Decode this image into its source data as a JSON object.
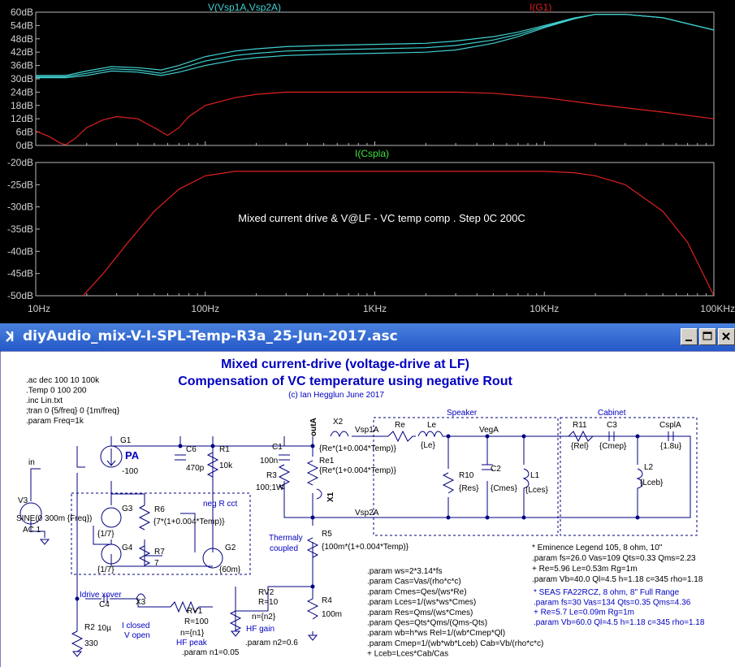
{
  "window": {
    "title": "diyAudio_mix-V-I-SPL-Temp-R3a_25-Jun-2017.asc"
  },
  "plot": {
    "annotation": "Mixed current drive & V@LF - VC temp comp . Step 0C 200C",
    "top_traces": [
      {
        "label": "V(Vsp1A,Vsp2A)",
        "color": "#40d0d0"
      },
      {
        "label": "I(G1)",
        "color": "#e02020"
      }
    ],
    "bottom_trace": {
      "label": "I(Cspla)",
      "color": "#40e040"
    },
    "top_y_ticks": [
      "60dB",
      "54dB",
      "48dB",
      "42dB",
      "36dB",
      "30dB",
      "24dB",
      "18dB",
      "12dB",
      "6dB",
      "0dB"
    ],
    "bottom_y_ticks": [
      "-20dB",
      "-25dB",
      "-30dB",
      "-35dB",
      "-40dB",
      "-45dB",
      "-50dB"
    ],
    "x_ticks": [
      "10Hz",
      "100Hz",
      "1KHz",
      "10KHz",
      "100KHz"
    ]
  },
  "chart_data": [
    {
      "type": "line",
      "x_scale": "log",
      "xlim": [
        10,
        100000
      ],
      "ylim": [
        0,
        60
      ],
      "y_unit": "dB",
      "grid": false,
      "series": [
        {
          "name": "V(Vsp1A,Vsp2A)",
          "variant": 1,
          "x": [
            10,
            15,
            20,
            28,
            40,
            55,
            70,
            100,
            150,
            200,
            300,
            500,
            1000,
            2000,
            3000,
            5000,
            7000,
            10000,
            15000,
            20000,
            30000,
            50000,
            100000
          ],
          "y": [
            30.5,
            30.5,
            31.5,
            33.5,
            33,
            31.5,
            33,
            36,
            38.5,
            39.5,
            40.5,
            41,
            41.5,
            42,
            43,
            46,
            49,
            53,
            57,
            59,
            59,
            57.5,
            52
          ]
        },
        {
          "name": "V(Vsp1A,Vsp2A)",
          "variant": 2,
          "x": [
            10,
            15,
            20,
            28,
            40,
            55,
            70,
            100,
            150,
            200,
            300,
            500,
            1000,
            2000,
            3000,
            5000,
            7000,
            10000,
            15000,
            20000,
            30000,
            50000,
            100000
          ],
          "y": [
            31,
            31,
            32.5,
            34.5,
            34,
            32.5,
            34.5,
            38,
            40.5,
            41.5,
            42.5,
            43,
            43.5,
            44,
            45,
            47.5,
            50,
            53.5,
            57.2,
            59,
            59,
            57.5,
            52
          ]
        },
        {
          "name": "V(Vsp1A,Vsp2A)",
          "variant": 3,
          "x": [
            10,
            15,
            20,
            28,
            40,
            55,
            70,
            100,
            150,
            200,
            300,
            500,
            1000,
            2000,
            3000,
            5000,
            7000,
            10000,
            15000,
            20000,
            30000,
            50000,
            100000
          ],
          "y": [
            31.5,
            31.5,
            33.5,
            35.5,
            35,
            34,
            36,
            40,
            42.5,
            43.5,
            44.5,
            45,
            45.5,
            46,
            47,
            49,
            51,
            54,
            57.4,
            59,
            59,
            57.5,
            52
          ]
        },
        {
          "name": "I(G1)",
          "x": [
            10,
            12,
            14,
            15,
            17,
            20,
            25,
            30,
            40,
            50,
            60,
            70,
            80,
            100,
            150,
            200,
            300,
            500,
            1000,
            2000,
            3000,
            5000,
            10000,
            20000,
            50000,
            100000
          ],
          "y": [
            6.5,
            4,
            1,
            0.3,
            3,
            8,
            11.5,
            13,
            12,
            8,
            4.5,
            8,
            13,
            18,
            21.5,
            23,
            24,
            24,
            24,
            24,
            24,
            23.5,
            21.5,
            18.5,
            15,
            12
          ]
        }
      ]
    },
    {
      "type": "line",
      "x_scale": "log",
      "xlim": [
        10,
        100000
      ],
      "ylim": [
        -50,
        -20
      ],
      "y_unit": "dB",
      "grid": false,
      "series": [
        {
          "name": "I(Cspla)",
          "x": [
            19,
            25,
            35,
            50,
            70,
            100,
            150,
            200,
            300,
            500,
            1000,
            2000,
            5000,
            10000,
            15000,
            20000,
            30000,
            50000,
            70000,
            100000
          ],
          "y": [
            -50,
            -45,
            -38,
            -31,
            -26,
            -23,
            -22,
            -22,
            -22,
            -22,
            -22,
            -22,
            -22,
            -22,
            -22.3,
            -23,
            -25,
            -31,
            -38,
            -50
          ]
        }
      ]
    }
  ],
  "schematic": {
    "title_line1": "Mixed current-drive (voltage-drive at LF)",
    "title_line2": "Compensation of VC temperature using negative Rout",
    "credit": "(c) Ian Hegglun June 2017",
    "directives": [
      ".ac dec 100 10 100k",
      ".Temp 0 100 200",
      ".inc Lin.txt",
      ";tran 0 {5/freq} 0 {1m/freq}",
      ".param Freq=1k"
    ],
    "labels": {
      "g1": "G1",
      "pa": "PA",
      "g1_val": "-100",
      "c6": "C6",
      "c6_val": "470p",
      "r1": "R1",
      "r1_val": "10k",
      "c1": "C1",
      "c1_val": "100n",
      "r3": "R3",
      "r3_val": "100;1W",
      "in": "in",
      "v3": "V3",
      "v3_sine": "SINE(0 300m {Freq})",
      "v3_ac": "AC 1",
      "g3": "G3",
      "g3_val": "{1/7}",
      "r6": "R6",
      "r6_val": "{7*(1+0.004*Temp)}",
      "neg_r": "neg R cct",
      "g4": "G4",
      "g4_val": "{1/7}",
      "r7": "R7",
      "r7_val": "7",
      "g2": "G2",
      "g2_val": "{60m}",
      "outa": "outA",
      "x2": "X2",
      "x2_val": "{Re*(1+0.004*Temp)}",
      "re1": "Re1",
      "re1_val": "{Re*(1+0.004*Temp)}",
      "x1": "X1",
      "thermal": "Thermaly",
      "coupled": "coupled",
      "r5": "R5",
      "r5_val": "{100m*(1+0.004*Temp)}",
      "vsp1a": "Vsp1A",
      "vsp2a": "Vsp2A",
      "vega": "VegA",
      "speaker": "Speaker",
      "cabinet": "Cabinet",
      "re": "Re",
      "le": "Le",
      "le_val": "{Le}",
      "r10": "R10",
      "r10_val": "{Res}",
      "c2": "C2",
      "c2_val": "{Cmes}",
      "l1": "L1",
      "l1_val": "{Lces}",
      "r11": "R11",
      "r11_val": "{Rel}",
      "c3": "C3",
      "c3_val": "{Cmep}",
      "cspla": "CsplA",
      "cspla_val": "{1.8u}",
      "l2": "L2",
      "l2_val": "{Lceb}",
      "idrive": "Idrive xover",
      "c4": "C4",
      "c4_val": "10µ",
      "x3": "X3",
      "iclosed": "I closed",
      "vopen": "V open",
      "rv1": "RV1",
      "rv1_r": "R=100",
      "rv1_n": "n={n1}",
      "hfpeak": "HF peak",
      "param_n1": ".param n1=0.05",
      "rv2": "RV2",
      "rv2_r": "R=10",
      "rv2_n": "n={n2}",
      "hfgain": "HF gain",
      "param_n2": ".param n2=0.6",
      "r4": "R4",
      "r4_val": "100m",
      "r2": "R2",
      "r2_val": "330"
    },
    "params": [
      ".param ws=2*3.14*fs",
      ".param Cas=Vas/(rho*c*c)",
      ".param Cmes=Qes/(ws*Re)",
      ".param Lces=1/(ws*ws*Cmes)",
      ".param Res=Qms/(ws*Cmes)",
      ".param Qes=Qts*Qms/(Qms-Qts)",
      ".param wb=h*ws Rel=1/(wb*Cmep*Ql)",
      ".param Cmep=1/(wb*wb*Lceb) Cab=Vb/(rho*c*c)",
      "+ Lceb=Lces*Cab/Cas"
    ],
    "notes_black": [
      "* Eminence Legend 105, 8 ohm, 10\"",
      ".param fs=26.0 Vas=109 Qts=0.33 Qms=2.23",
      "+ Re=5.96 Le=0.53m Rg=1m",
      ".param Vb=40.0 Ql=4.5 h=1.18  c=345 rho=1.18"
    ],
    "notes_blue": [
      "* SEAS FA22RCZ, 8 ohm, 8\" Full Range",
      ".param fs=30 Vas=134 Qts=0.35 Qms=4.36",
      "+ Re=5.7 Le=0.09m Rg=1m",
      ".param Vb=60.0 Ql=4.5 h=1.18  c=345 rho=1.18"
    ]
  }
}
